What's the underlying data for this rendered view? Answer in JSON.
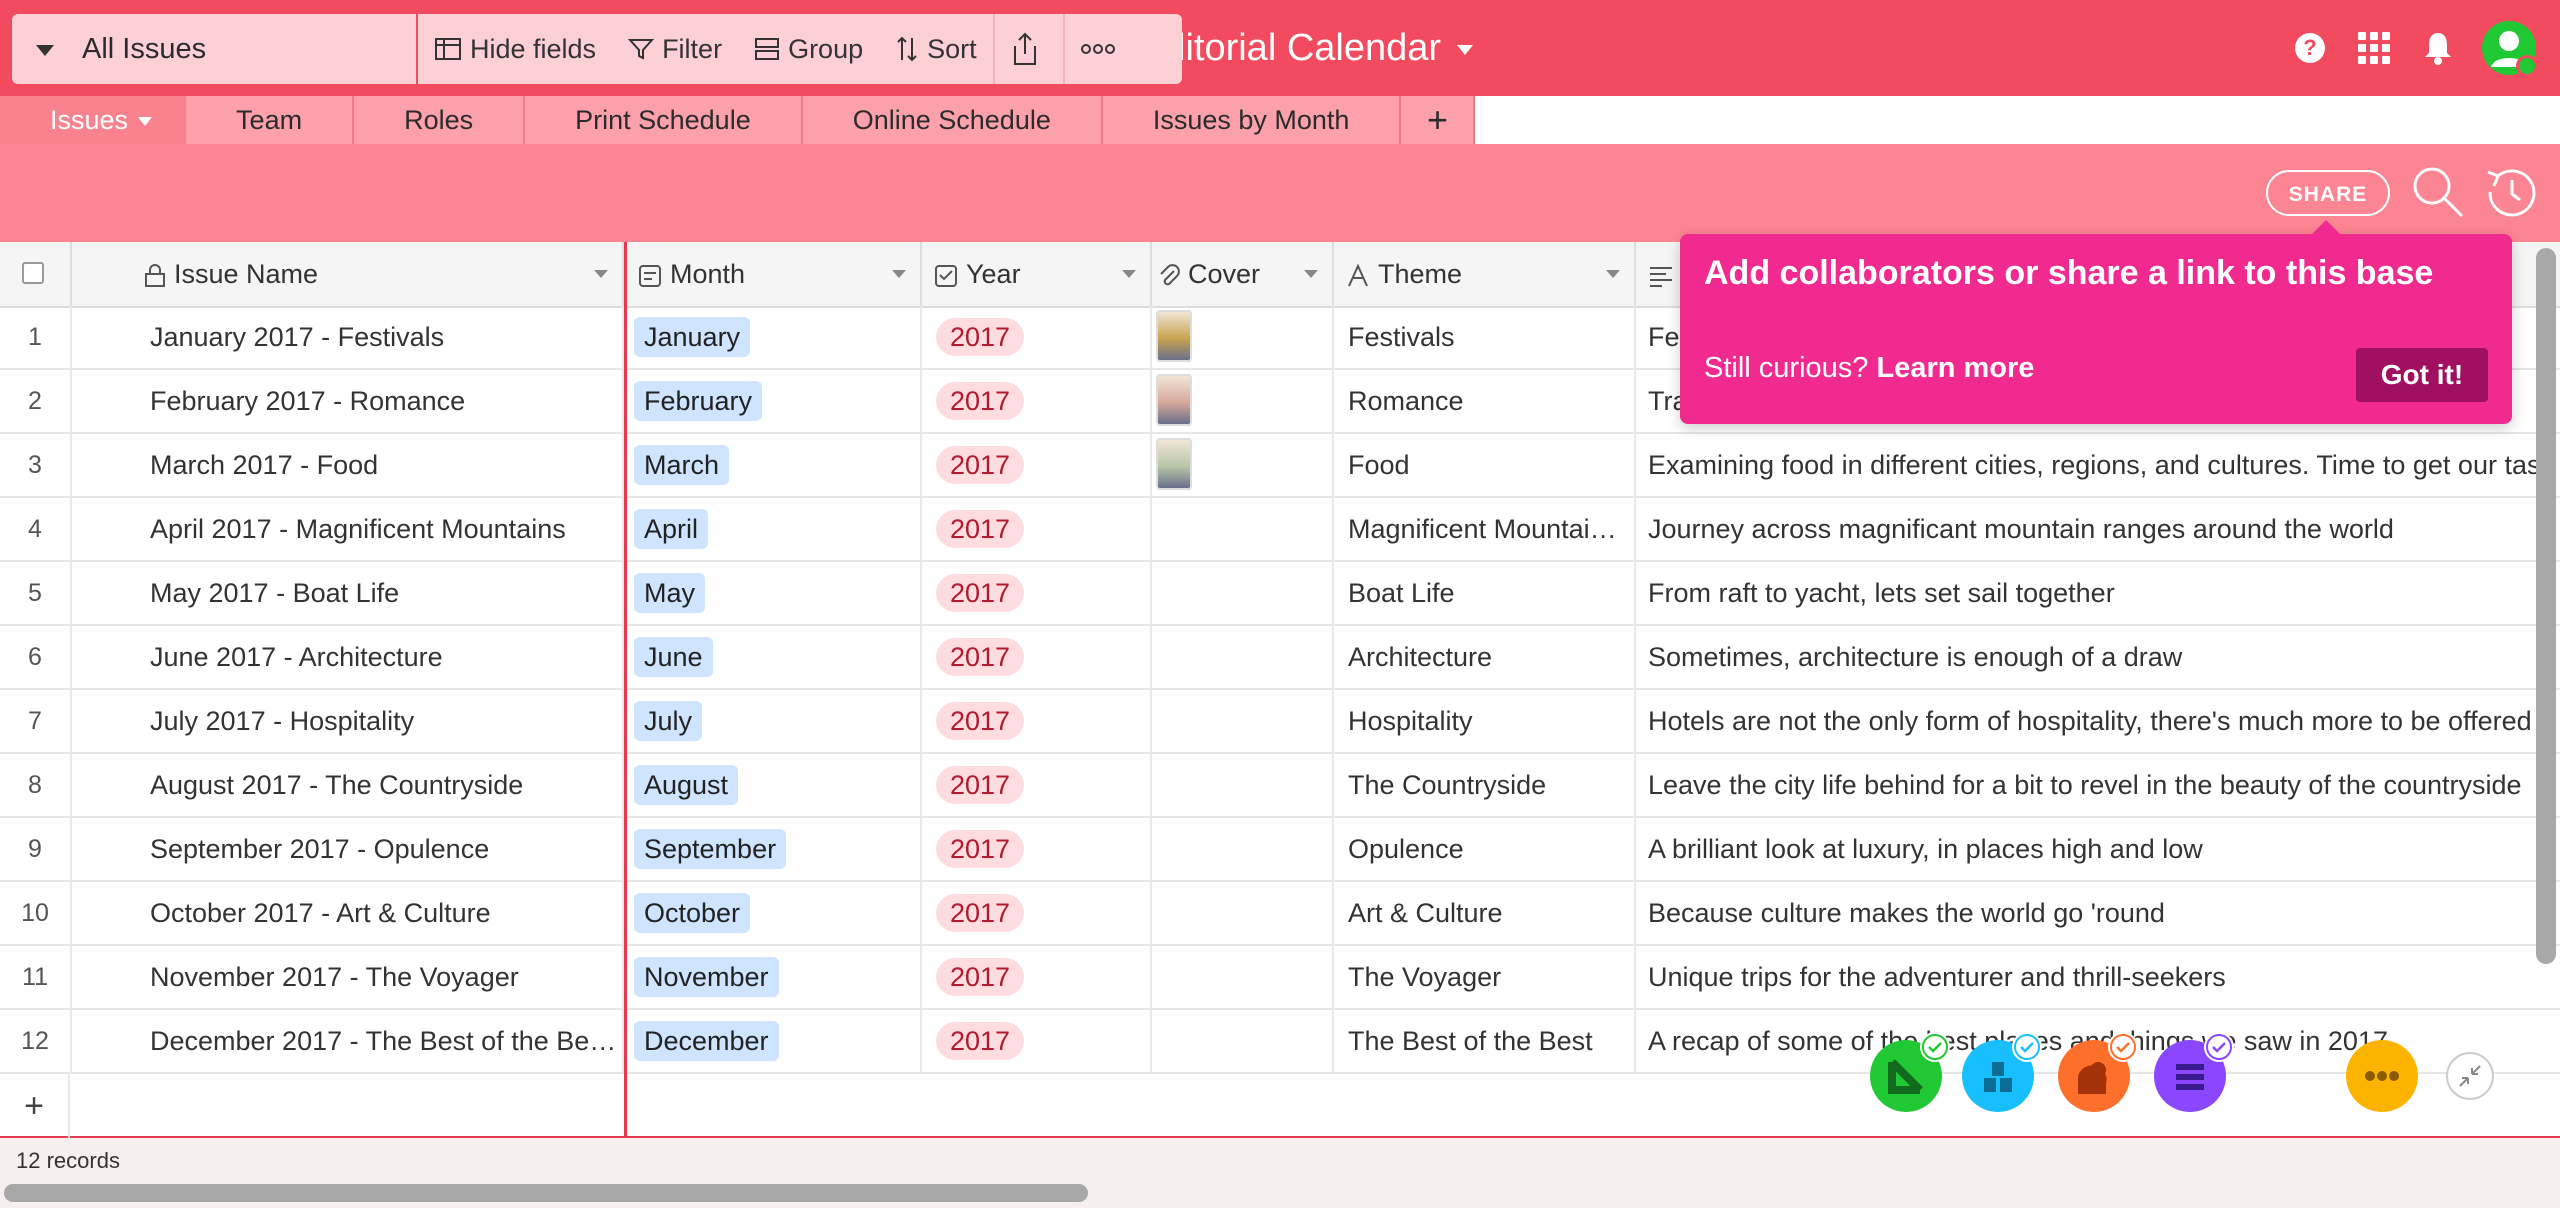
{
  "base": {
    "title": "Editorial Calendar"
  },
  "tabs": [
    {
      "label": "Issues"
    },
    {
      "label": "Team"
    },
    {
      "label": "Roles"
    },
    {
      "label": "Print Schedule"
    },
    {
      "label": "Online Schedule"
    },
    {
      "label": "Issues by Month"
    },
    {
      "label": "+"
    }
  ],
  "toolbar": {
    "view_name": "All Issues",
    "hide_fields": "Hide fields",
    "filter": "Filter",
    "group": "Group",
    "sort": "Sort",
    "share": "SHARE"
  },
  "columns": [
    {
      "label": "Issue Name",
      "icon": "lock-icon"
    },
    {
      "label": "Month",
      "icon": "single-select-icon"
    },
    {
      "label": "Year",
      "icon": "checkbox-select-icon"
    },
    {
      "label": "Cover",
      "icon": "attachment-icon"
    },
    {
      "label": "Theme",
      "icon": "text-icon"
    }
  ],
  "rows": [
    {
      "num": "1",
      "name": "January 2017 - Festivals",
      "month": "January",
      "year": "2017",
      "cover": true,
      "theme": "Festivals",
      "desc": "Fe"
    },
    {
      "num": "2",
      "name": "February 2017 - Romance",
      "month": "February",
      "year": "2017",
      "cover": true,
      "theme": "Romance",
      "desc": "Tra"
    },
    {
      "num": "3",
      "name": "March 2017 - Food",
      "month": "March",
      "year": "2017",
      "cover": true,
      "theme": "Food",
      "desc": "Examining food in different cities, regions, and cultures. Time to get our tas"
    },
    {
      "num": "4",
      "name": "April 2017 - Magnificent Mountains",
      "month": "April",
      "year": "2017",
      "cover": false,
      "theme": "Magnificent Mountai…",
      "desc": "Journey across magnificant mountain ranges around the world"
    },
    {
      "num": "5",
      "name": "May 2017 - Boat Life",
      "month": "May",
      "year": "2017",
      "cover": false,
      "theme": "Boat Life",
      "desc": "From raft to yacht, lets set sail together"
    },
    {
      "num": "6",
      "name": "June 2017 - Architecture",
      "month": "June",
      "year": "2017",
      "cover": false,
      "theme": "Architecture",
      "desc": "Sometimes, architecture is enough of a draw"
    },
    {
      "num": "7",
      "name": "July 2017 - Hospitality",
      "month": "July",
      "year": "2017",
      "cover": false,
      "theme": "Hospitality",
      "desc": "Hotels are not the only form of hospitality, there's much more to be offered"
    },
    {
      "num": "8",
      "name": "August 2017 - The Countryside",
      "month": "August",
      "year": "2017",
      "cover": false,
      "theme": "The Countryside",
      "desc": "Leave the city life behind for a bit to revel in the beauty of the countryside"
    },
    {
      "num": "9",
      "name": "September 2017 - Opulence",
      "month": "September",
      "year": "2017",
      "cover": false,
      "theme": "Opulence",
      "desc": "A brilliant look at luxury, in places high and low"
    },
    {
      "num": "10",
      "name": "October 2017 - Art & Culture",
      "month": "October",
      "year": "2017",
      "cover": false,
      "theme": "Art & Culture",
      "desc": "Because culture makes the world go 'round"
    },
    {
      "num": "11",
      "name": "November 2017 - The Voyager",
      "month": "November",
      "year": "2017",
      "cover": false,
      "theme": "The Voyager",
      "desc": "Unique trips for the adventurer and thrill-seekers"
    },
    {
      "num": "12",
      "name": "December 2017 - The Best of the Be…",
      "month": "December",
      "year": "2017",
      "cover": false,
      "theme": "The Best of the Best",
      "desc": "A recap of some of the best places and things we saw in 2017"
    }
  ],
  "footer": {
    "records": "12 records"
  },
  "popover": {
    "title": "Add collaborators or share a link to this base",
    "prefix": "Still curious?",
    "link": "Learn more",
    "button": "Got it!"
  },
  "apps": [
    {
      "name": "app-green",
      "color": "#20c933"
    },
    {
      "name": "app-blue",
      "color": "#18bfff"
    },
    {
      "name": "app-orange",
      "color": "#ff6f2c"
    },
    {
      "name": "app-purple",
      "color": "#8b46ff"
    },
    {
      "name": "more-apps",
      "color": "#fcb400"
    }
  ],
  "colors": {
    "brand": "#f24a5e",
    "popover": "#f02a8e",
    "frozen_line": "#e8384f"
  }
}
